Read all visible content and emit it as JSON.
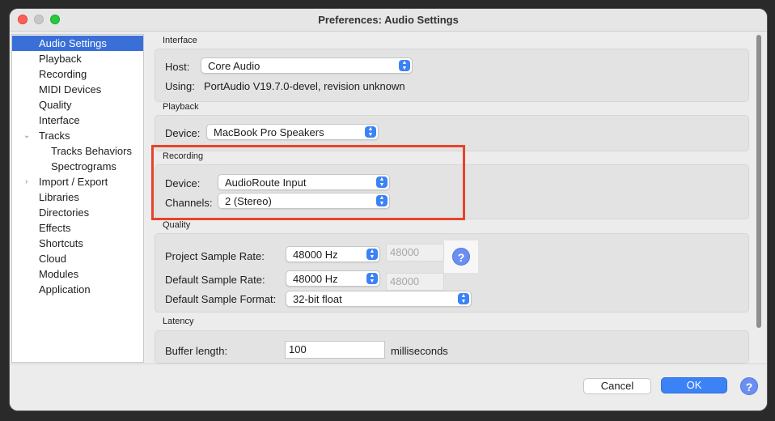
{
  "window": {
    "title": "Preferences: Audio Settings"
  },
  "sidebar": {
    "items": [
      {
        "label": "Audio Settings",
        "selected": true
      },
      {
        "label": "Playback"
      },
      {
        "label": "Recording"
      },
      {
        "label": "MIDI Devices"
      },
      {
        "label": "Quality"
      },
      {
        "label": "Interface"
      },
      {
        "label": "Tracks",
        "expanded": true
      },
      {
        "label": "Tracks Behaviors"
      },
      {
        "label": "Spectrograms"
      },
      {
        "label": "Import / Export",
        "expanded": false
      },
      {
        "label": "Libraries"
      },
      {
        "label": "Directories"
      },
      {
        "label": "Effects"
      },
      {
        "label": "Shortcuts"
      },
      {
        "label": "Cloud"
      },
      {
        "label": "Modules"
      },
      {
        "label": "Application"
      }
    ]
  },
  "interface": {
    "title": "Interface",
    "host_label": "Host:",
    "host_value": "Core Audio",
    "using_label": "Using:",
    "using_value": "PortAudio V19.7.0-devel, revision unknown"
  },
  "playback": {
    "title": "Playback",
    "device_label": "Device:",
    "device_value": "MacBook Pro Speakers"
  },
  "recording": {
    "title": "Recording",
    "device_label": "Device:",
    "device_value": "AudioRoute Input",
    "channels_label": "Channels:",
    "channels_value": "2 (Stereo)"
  },
  "quality": {
    "title": "Quality",
    "project_rate_label": "Project Sample Rate:",
    "project_rate_value": "48000 Hz",
    "project_rate_text": "48000",
    "default_rate_label": "Default Sample Rate:",
    "default_rate_value": "48000 Hz",
    "default_rate_text": "48000",
    "format_label": "Default Sample Format:",
    "format_value": "32-bit float",
    "help_symbol": "?"
  },
  "latency": {
    "title": "Latency",
    "buffer_label": "Buffer length:",
    "buffer_value": "100",
    "buffer_unit": "milliseconds"
  },
  "buttons": {
    "cancel": "Cancel",
    "ok": "OK",
    "help": "?"
  },
  "colors": {
    "accent": "#3b82f6",
    "highlight": "#e8432a",
    "selected": "#3a6fd8"
  }
}
